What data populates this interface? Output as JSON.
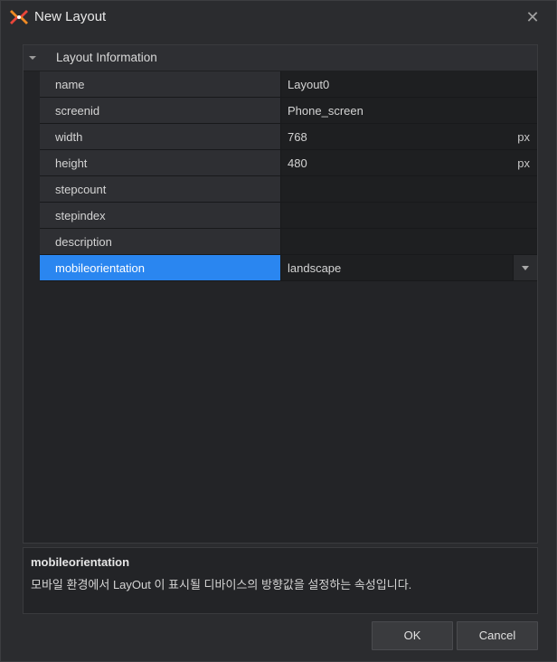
{
  "window": {
    "title": "New Layout",
    "close_symbol": "✕"
  },
  "property_grid": {
    "group_label": "Layout Information",
    "rows": [
      {
        "name": "name",
        "value": "Layout0",
        "unit": ""
      },
      {
        "name": "screenid",
        "value": "Phone_screen",
        "unit": ""
      },
      {
        "name": "width",
        "value": "768",
        "unit": "px"
      },
      {
        "name": "height",
        "value": "480",
        "unit": "px"
      },
      {
        "name": "stepcount",
        "value": "",
        "unit": ""
      },
      {
        "name": "stepindex",
        "value": "",
        "unit": ""
      },
      {
        "name": "description",
        "value": "",
        "unit": ""
      },
      {
        "name": "mobileorientation",
        "value": "landscape",
        "unit": ""
      }
    ],
    "selected_row": "mobileorientation"
  },
  "description_panel": {
    "title": "mobileorientation",
    "text": "모바일 환경에서 LayOut 이 표시될 디바이스의 방향값을 설정하는 속성입니다."
  },
  "buttons": {
    "ok_label": "OK",
    "cancel_label": "Cancel"
  },
  "colors": {
    "accent": "#2a86f0",
    "dialog_bg": "#2b2c2f",
    "grid_bg": "#232427"
  }
}
